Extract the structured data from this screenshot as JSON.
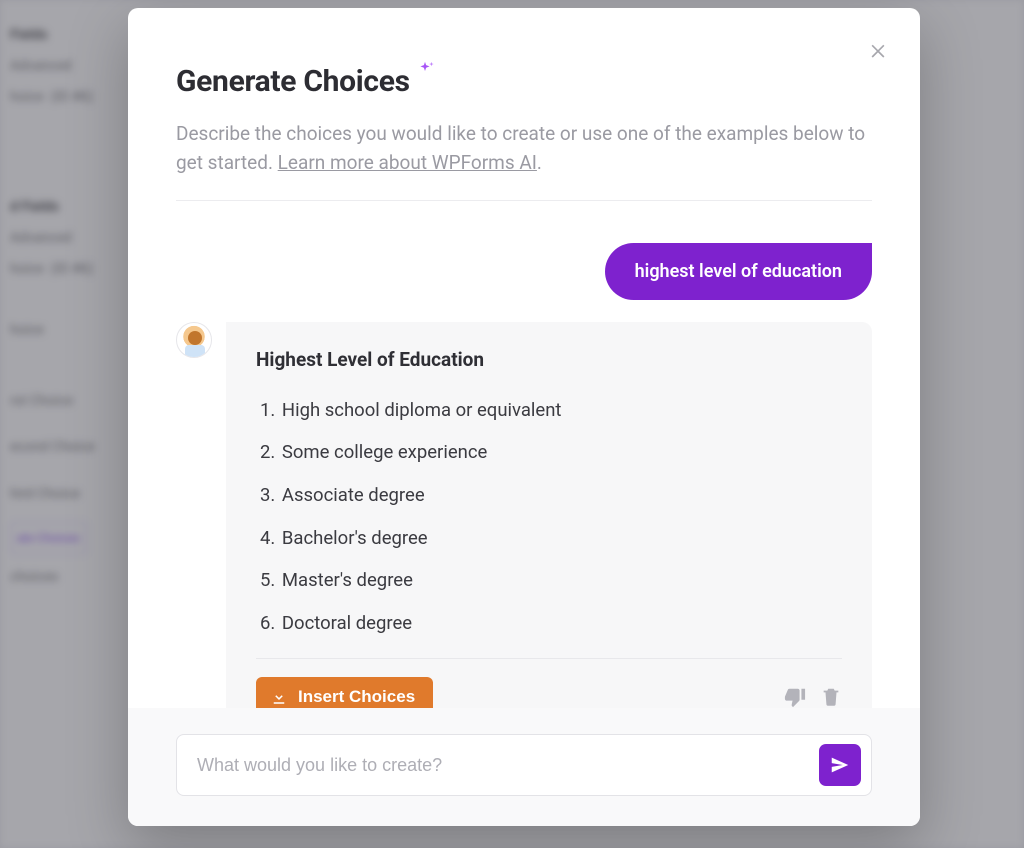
{
  "background": {
    "sidebar_items": [
      "Fields",
      "Advanced",
      "hoice",
      "d Fields",
      "Advanced",
      "hoice",
      "hoice",
      "rst Choice",
      "econd Choice",
      "hird Choice",
      "ate Choices",
      "choices"
    ]
  },
  "modal": {
    "title": "Generate Choices",
    "subtitle_a": "Describe the choices you would like to create or use one of the examples below to get started. ",
    "learn_more": "Learn more about WPForms AI",
    "subtitle_b": "."
  },
  "chat": {
    "user_message": "highest level of education",
    "ai_title": "Highest Level of Education",
    "choices": [
      "High school diploma or equivalent",
      "Some college experience",
      "Associate degree",
      "Bachelor's degree",
      "Master's degree",
      "Doctoral degree"
    ],
    "insert_label": "Insert Choices"
  },
  "input": {
    "placeholder": "What would you like to create?"
  },
  "colors": {
    "accent": "#7e22ce",
    "insert": "#e07a2c"
  }
}
